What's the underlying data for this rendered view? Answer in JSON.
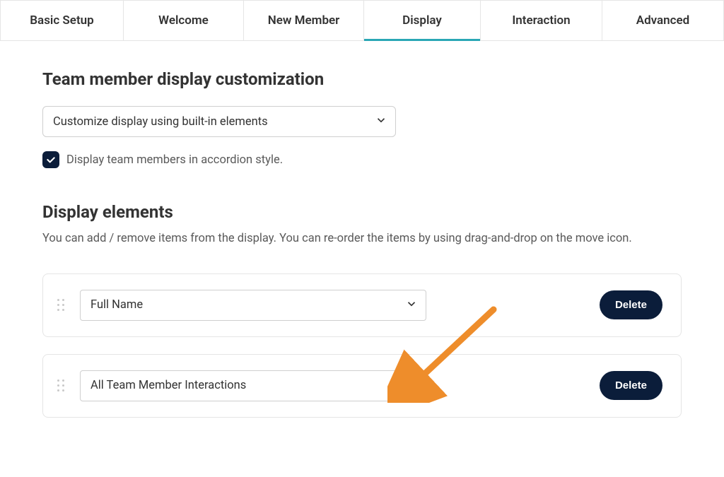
{
  "tabs": [
    {
      "label": "Basic Setup",
      "width": 175
    },
    {
      "label": "Welcome",
      "width": 170
    },
    {
      "label": "New Member",
      "width": 170
    },
    {
      "label": "Display",
      "width": 165,
      "active": true
    },
    {
      "label": "Interaction",
      "width": 172
    },
    {
      "label": "Advanced",
      "width": 172
    }
  ],
  "sections": {
    "customization": {
      "title": "Team member display customization",
      "select_value": "Customize display using built-in elements",
      "checkbox_checked": true,
      "checkbox_label": "Display team members in accordion style."
    },
    "elements": {
      "title": "Display elements",
      "description": "You can add / remove items from the display. You can re-order the items by using drag-and-drop on the move icon.",
      "items": [
        {
          "value": "Full Name",
          "delete_label": "Delete"
        },
        {
          "value": "All Team Member Interactions",
          "delete_label": "Delete"
        }
      ]
    }
  }
}
